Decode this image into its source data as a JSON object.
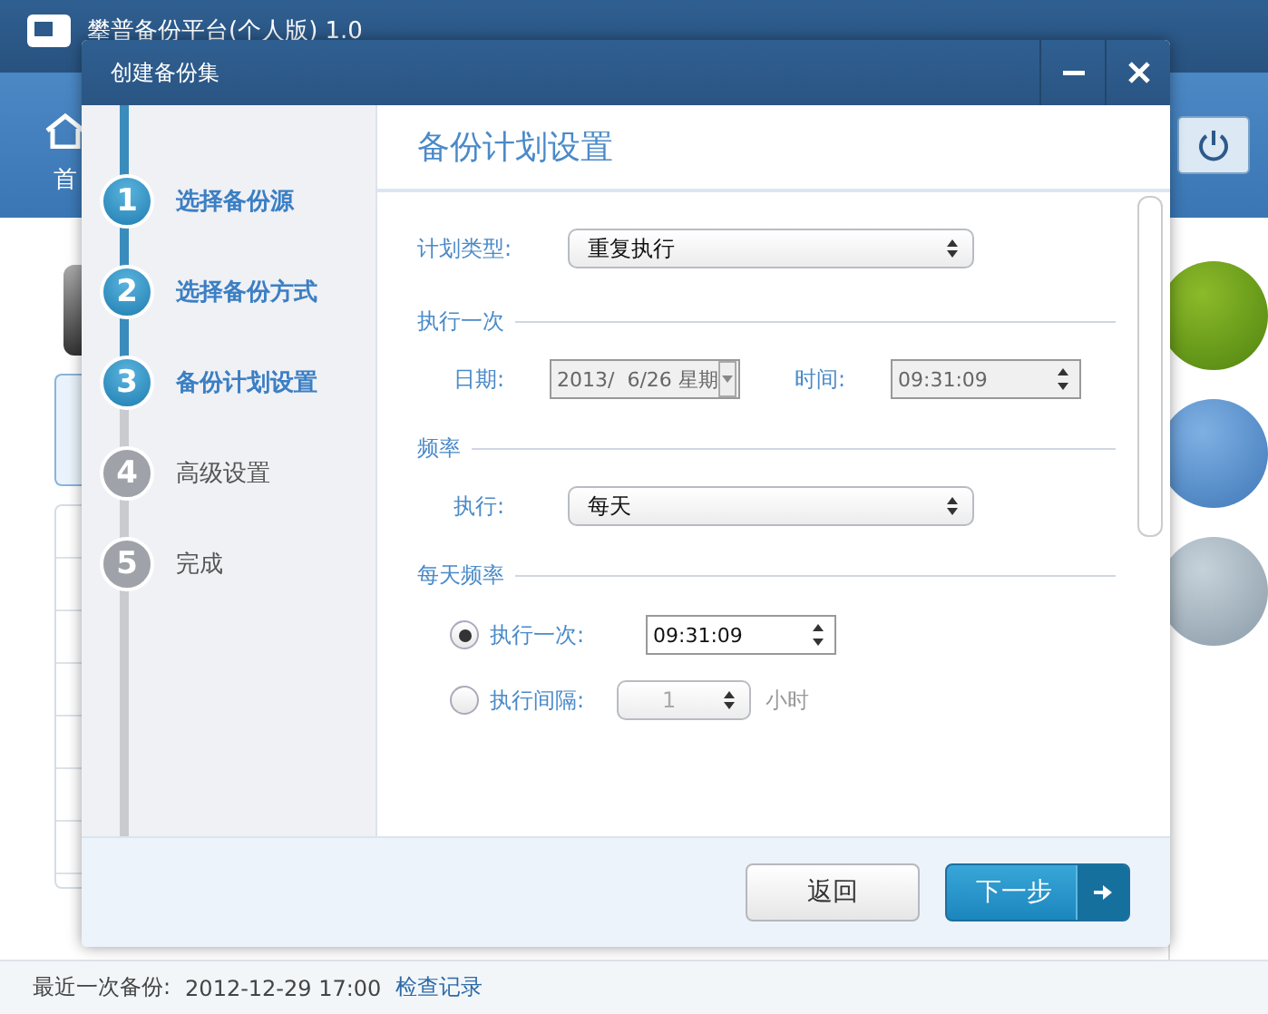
{
  "main_window": {
    "title": "攀普备份平台(个人版) 1.0",
    "toolbar_label": "首",
    "status_bar": {
      "label": "最近一次备份:",
      "time": "2012-12-29 17:00",
      "link": "检查记录"
    }
  },
  "dialog": {
    "title": "创建备份集",
    "steps": [
      {
        "number": "1",
        "label": "选择备份源",
        "done": true
      },
      {
        "number": "2",
        "label": "选择备份方式",
        "done": true
      },
      {
        "number": "3",
        "label": "备份计划设置",
        "done": true
      },
      {
        "number": "4",
        "label": "高级设置",
        "done": false
      },
      {
        "number": "5",
        "label": "完成",
        "done": false
      }
    ],
    "heading": "备份计划设置",
    "plan_type": {
      "label": "计划类型:",
      "value": "重复执行"
    },
    "once": {
      "title": "执行一次",
      "date_label": "日期:",
      "date_value": "2013/  6/26 星期",
      "time_label": "时间:",
      "time_value": "09:31:09",
      "disabled": true
    },
    "frequency": {
      "title": "频率",
      "label": "执行:",
      "value": "每天"
    },
    "daily": {
      "title": "每天频率",
      "options": [
        {
          "kind": "time",
          "label": "执行一次:",
          "value": "09:31:09",
          "selected": true
        },
        {
          "kind": "interval",
          "label": "执行间隔:",
          "value": "1",
          "unit": "小时",
          "selected": false
        }
      ]
    },
    "buttons": [
      {
        "kind": "secondary",
        "label": "返回"
      },
      {
        "kind": "primary",
        "label": "下一步"
      }
    ]
  }
}
